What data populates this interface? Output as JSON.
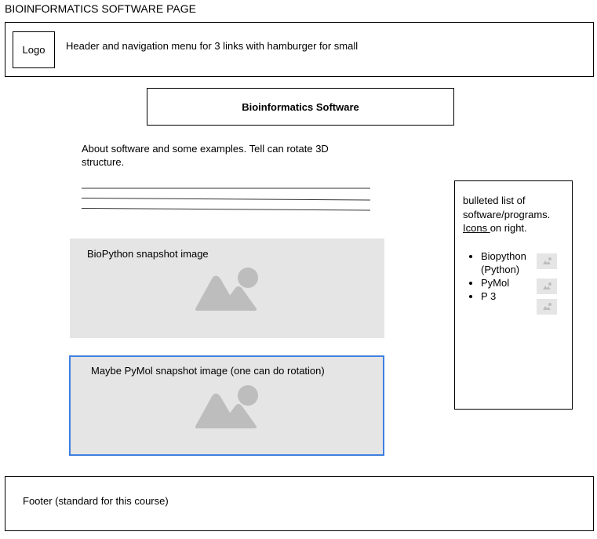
{
  "page_title": "BIOINFORMATICS SOFTWARE PAGE",
  "header": {
    "logo_label": "Logo",
    "description": "Header and navigation menu for 3 links with hamburger for small"
  },
  "main": {
    "title": "Bioinformatics Software",
    "about": "About software and some examples. Tell can rotate 3D structure.",
    "images": [
      {
        "label": "BioPython snapshot image"
      },
      {
        "label": "Maybe PyMol snapshot image (one can do rotation)"
      }
    ]
  },
  "sidebar": {
    "intro_before": "bulleted list of software/programs. ",
    "intro_underlined": "Icons ",
    "intro_after": "on right.",
    "items": [
      {
        "label": "Biopython (Python)"
      },
      {
        "label": "PyMol"
      },
      {
        "label": "P 3"
      }
    ]
  },
  "footer": {
    "text": "Footer (standard for this course)"
  },
  "colors": {
    "placeholder_fill": "#e5e5e5",
    "icon_fill": "#bdbdbd",
    "selection_border": "#3d7fe0"
  }
}
